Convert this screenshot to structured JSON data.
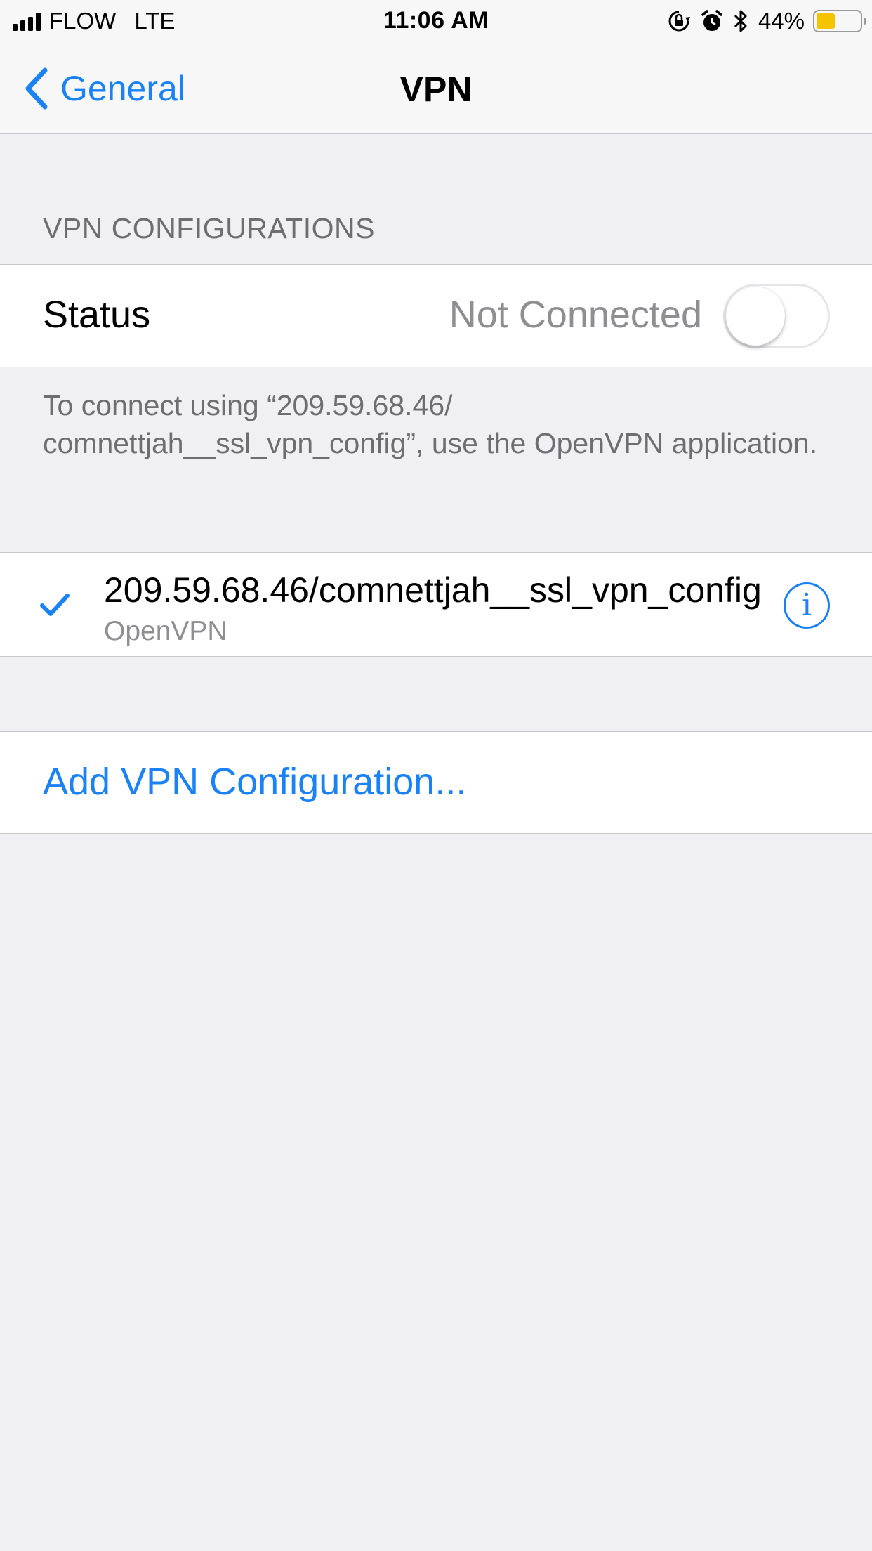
{
  "status_bar": {
    "carrier": "FLOW",
    "network": "LTE",
    "time": "11:06 AM",
    "battery_percent": "44%",
    "battery_level": 0.44,
    "icons": [
      "signal-icon",
      "orientation-lock-icon",
      "alarm-icon",
      "bluetooth-icon",
      "battery-icon"
    ]
  },
  "nav": {
    "back_label": "General",
    "title": "VPN"
  },
  "vpn_section": {
    "header": "VPN CONFIGURATIONS",
    "status_label": "Status",
    "status_value": "Not Connected",
    "toggle_on": false,
    "footer": "To connect using “209.59.68.46/ comnettjah__ssl_vpn_config”, use the OpenVPN application."
  },
  "configuration": {
    "selected": true,
    "name": "209.59.68.46/comnettjah__ssl_vpn_config",
    "type": "OpenVPN"
  },
  "add": {
    "label": "Add VPN Configuration..."
  },
  "colors": {
    "accent": "#1a82f7",
    "background": "#efeff4",
    "secondary_text": "#8e8e93",
    "battery": "#f5c400"
  }
}
